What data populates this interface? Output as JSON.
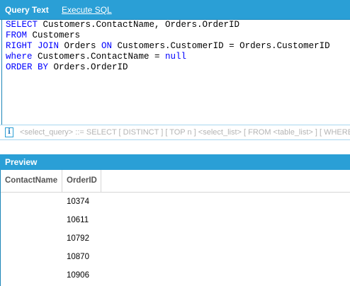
{
  "tabs": {
    "query_text": "Query Text",
    "execute_sql": "Execute SQL"
  },
  "sql": {
    "line1": {
      "kw1": "SELECT",
      "rest": " Customers.ContactName, Orders.OrderID"
    },
    "line2": {
      "kw1": "FROM",
      "rest": " Customers"
    },
    "line3": {
      "kw1": "RIGHT JOIN",
      "mid": " Orders ",
      "kw2": "ON",
      "rest": " Customers.CustomerID = Orders.CustomerID"
    },
    "line4": {
      "kw1": "where",
      "mid": " Customers.ContactName = ",
      "kw2": "null"
    },
    "line5": {
      "kw1": "ORDER BY",
      "rest": " Orders.OrderID"
    }
  },
  "hint": {
    "icon": "info-icon",
    "text": "<select_query> ::= SELECT [ DISTINCT ] [ TOP n ] <select_list> [ FROM <table_list> ] [ WHERE"
  },
  "preview": {
    "title": "Preview",
    "columns": [
      "ContactName",
      "OrderID"
    ],
    "rows": [
      {
        "contact": "",
        "order": "10374"
      },
      {
        "contact": "",
        "order": "10611"
      },
      {
        "contact": "",
        "order": "10792"
      },
      {
        "contact": "",
        "order": "10870"
      },
      {
        "contact": "",
        "order": "10906"
      }
    ]
  },
  "colors": {
    "accent": "#2a9fd6",
    "keyword": "#0000ff",
    "hint_text": "#b4b4b4"
  }
}
